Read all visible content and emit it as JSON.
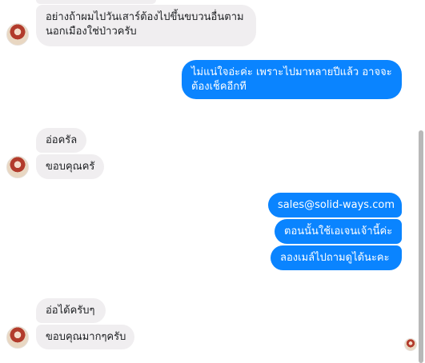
{
  "messages": {
    "m1": "อย่างถ้าผมไปวันเสาร์ต้องไปขึ้นขบวนอื่นตาม\nนอกเมืองใช่ป่าวครับ",
    "m2": "ไม่แน่ใจอ่ะค่ะ เพราะไปมาหลายปีแล้ว อาจจะ\nต้องเช็คอีกที",
    "m3": "อ่อครัล",
    "m4": "ขอบคุณครั",
    "m5": "sales@solid-ways.com",
    "m6": "ตอนนั้นใช้เอเจนเจ้านี้ค่ะ",
    "m7": "ลองเมล์ไปถามดูได้นะคะ",
    "m8": "อ่อได้ครับๆ",
    "m9": "ขอบคุณมากๆครับ"
  },
  "colors": {
    "incoming_bubble": "#f0eef0",
    "outgoing_bubble": "#0a84ff"
  }
}
